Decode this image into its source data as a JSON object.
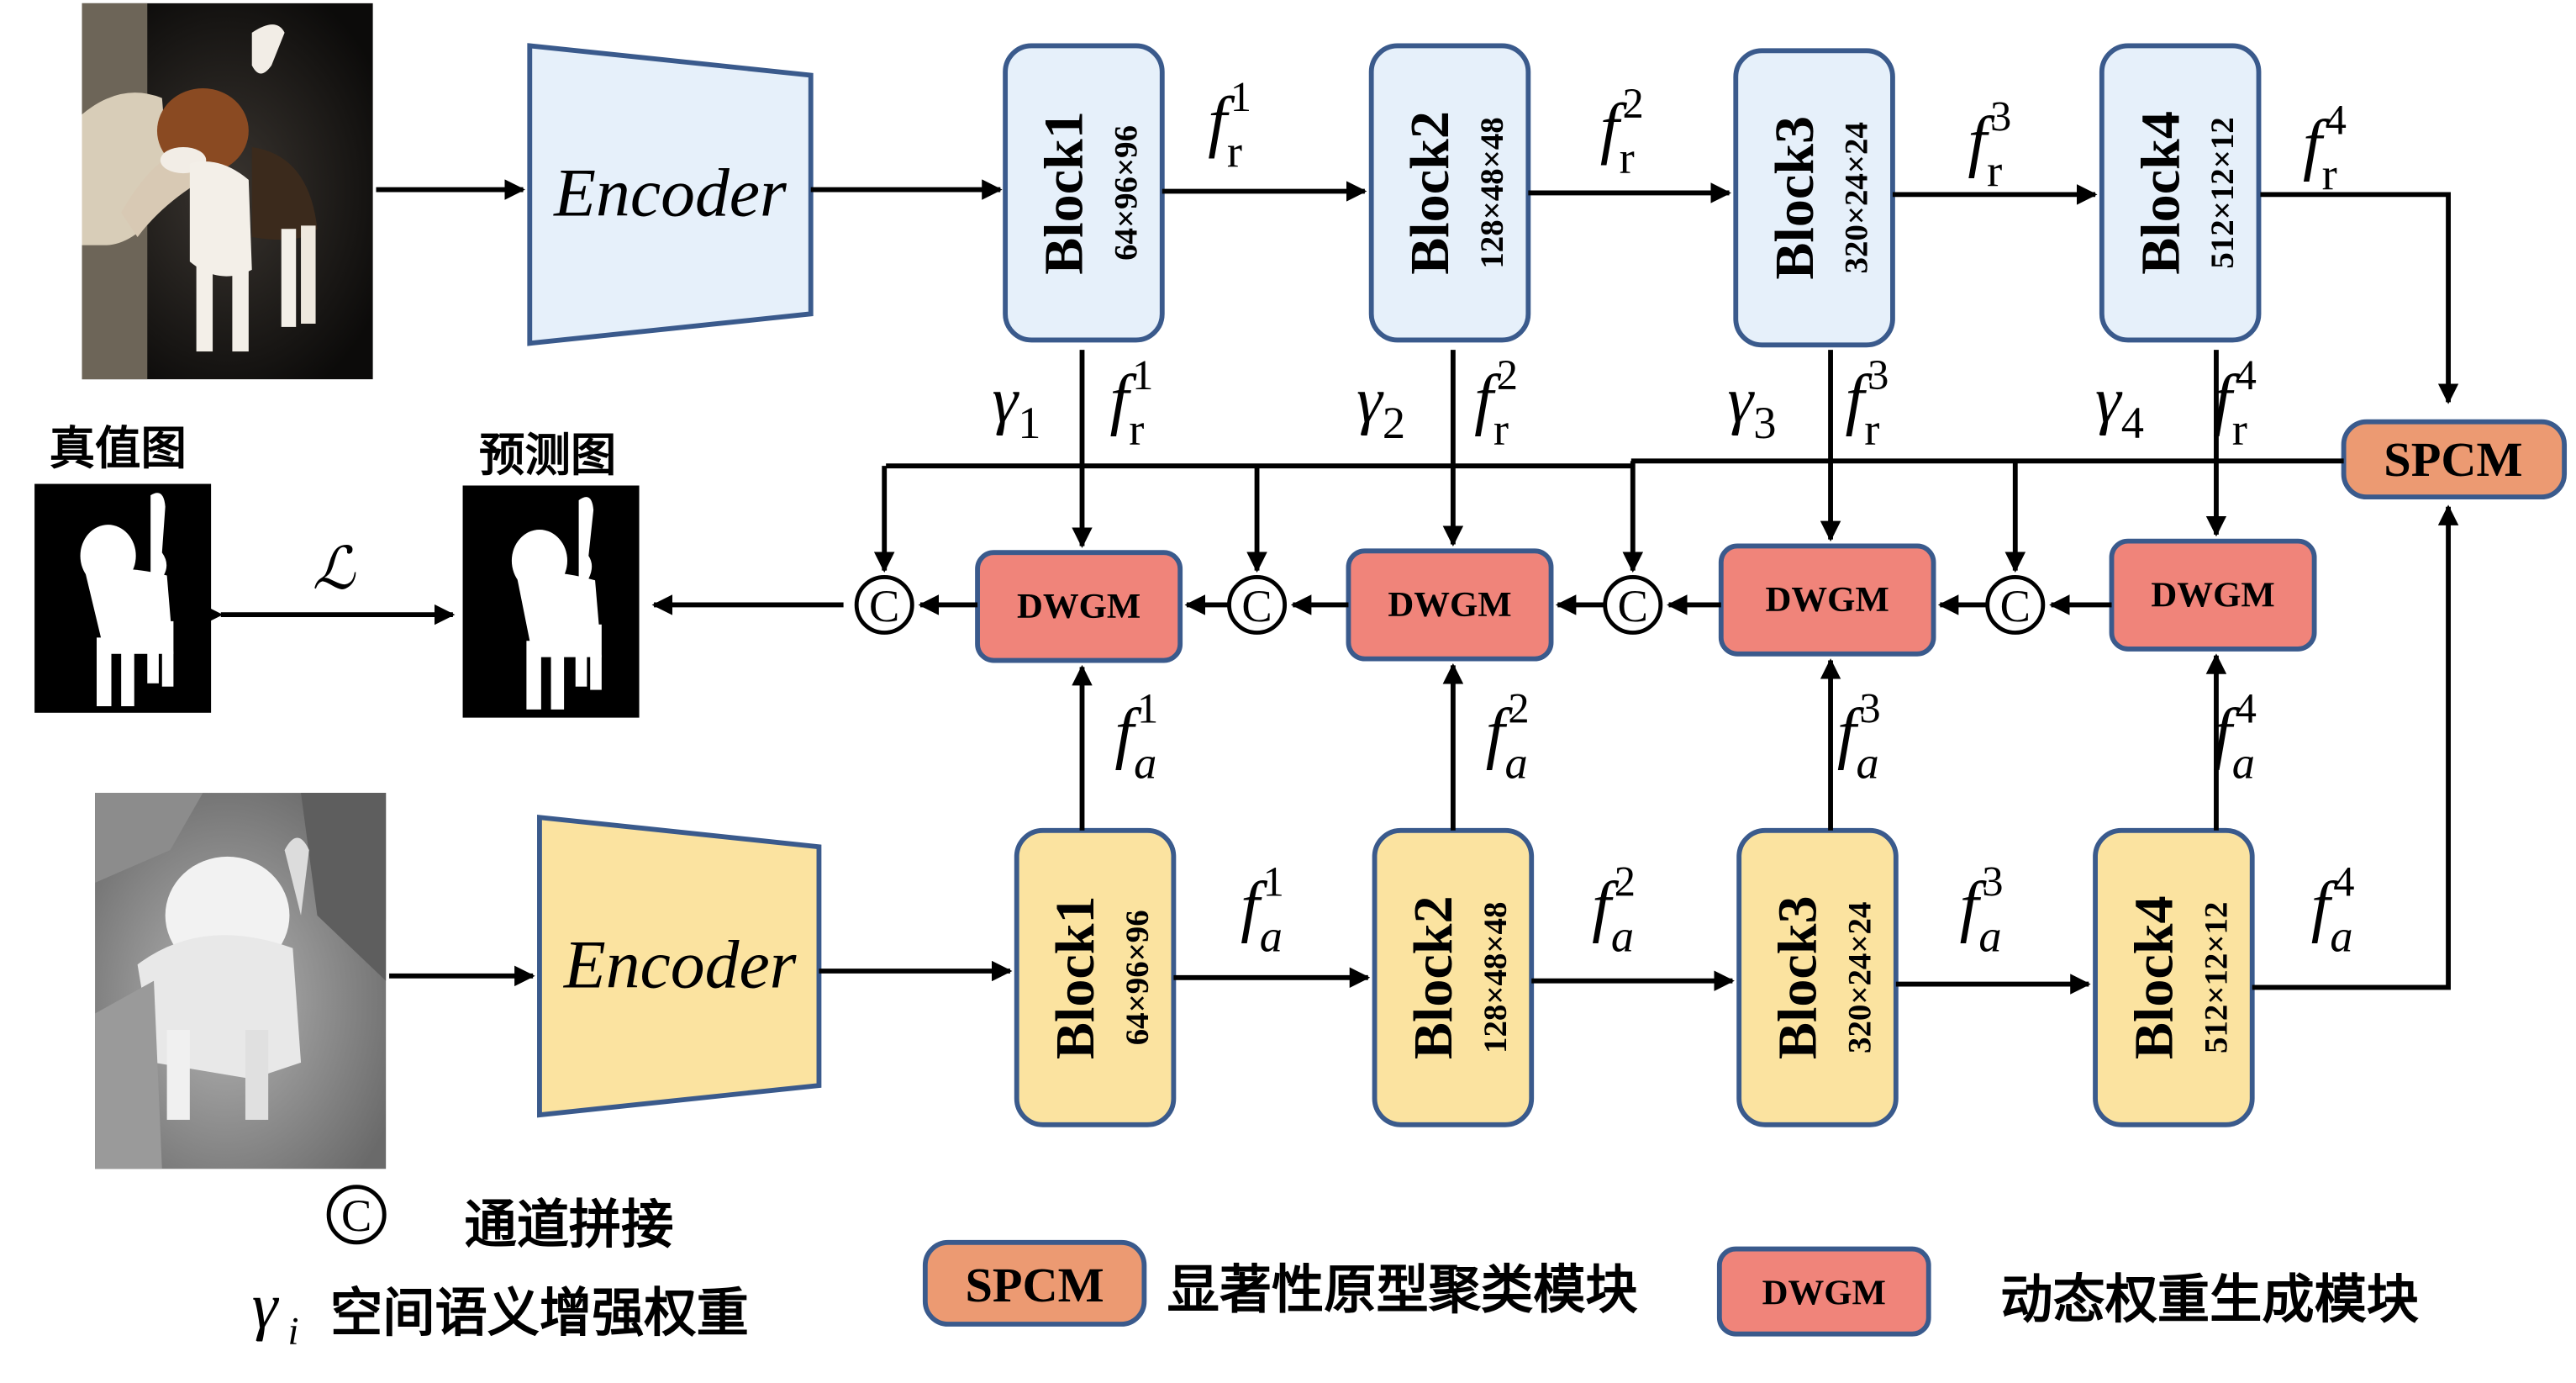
{
  "colors": {
    "rgb_fill": "#e6f0fa",
    "depth_fill": "#fbe3a0",
    "block_stroke": "#3a5a8c",
    "dwgm_fill": "#f0847a",
    "spcm_fill": "#ec9a72",
    "line": "#000000"
  },
  "rgb_encoder_label": "Encoder",
  "depth_encoder_label": "Encoder",
  "rgb_blocks": [
    {
      "name": "Block1",
      "dims": "64×96×96"
    },
    {
      "name": "Block2",
      "dims": "128×48×48"
    },
    {
      "name": "Block3",
      "dims": "320×24×24"
    },
    {
      "name": "Block4",
      "dims": "512×12×12"
    }
  ],
  "depth_blocks": [
    {
      "name": "Block1",
      "dims": "64×96×96"
    },
    {
      "name": "Block2",
      "dims": "128×48×48"
    },
    {
      "name": "Block3",
      "dims": "320×24×24"
    },
    {
      "name": "Block4",
      "dims": "512×12×12"
    }
  ],
  "dwgm_label": "DWGM",
  "spcm_label": "SPCM",
  "concat_symbol": "C",
  "rgb_feature": {
    "base": "f",
    "sub": "r",
    "sups": [
      "1",
      "2",
      "3",
      "4"
    ]
  },
  "depth_feature": {
    "base": "f",
    "sub": "a",
    "sups": [
      "1",
      "2",
      "3",
      "4"
    ]
  },
  "gamma": {
    "base": "γ",
    "subs": [
      "1",
      "2",
      "3",
      "4"
    ]
  },
  "loss_symbol": "ℒ",
  "ground_truth_label": "真值图",
  "prediction_label": "预测图",
  "legend": {
    "concat_text": "通道拼接",
    "gamma_symbol": "γ",
    "gamma_sub": "i",
    "gamma_text": "空间语义增强权重",
    "spcm_box": "SPCM",
    "spcm_text": "显著性原型聚类模块",
    "dwgm_box": "DWGM",
    "dwgm_text": "动态权重生成模块"
  }
}
